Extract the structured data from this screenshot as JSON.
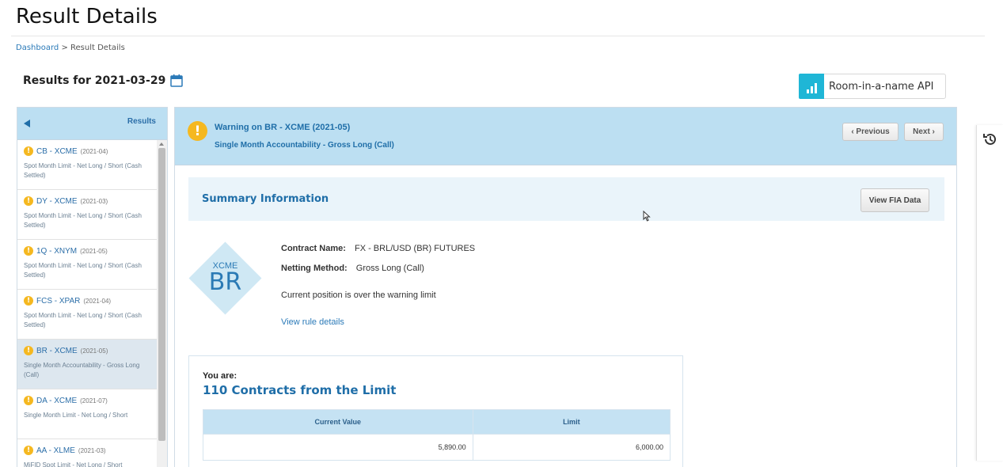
{
  "page": {
    "title": "Result Details",
    "breadcrumb": {
      "home": "Dashboard",
      "separator": ">",
      "current": "Result Details"
    },
    "results_for": "Results for 2021-03-29"
  },
  "api_button": {
    "label": "Room-in-a-name API",
    "icon": "bar-chart-icon",
    "icon_color": "#1fb6d6"
  },
  "sidebar": {
    "title": "Results",
    "items": [
      {
        "name": "CB - XCME",
        "date": "(2021-04)",
        "desc": "Spot Month Limit - Net Long / Short (Cash Settled)",
        "active": false
      },
      {
        "name": "DY - XCME",
        "date": "(2021-03)",
        "desc": "Spot Month Limit - Net Long / Short (Cash Settled)",
        "active": false
      },
      {
        "name": "1Q - XNYM",
        "date": "(2021-05)",
        "desc": "Spot Month Limit - Net Long / Short (Cash Settled)",
        "active": false
      },
      {
        "name": "FCS - XPAR",
        "date": "(2021-04)",
        "desc": "Spot Month Limit - Net Long / Short (Cash Settled)",
        "active": false
      },
      {
        "name": "BR - XCME",
        "date": "(2021-05)",
        "desc": "Single Month Accountability - Gross Long (Call)",
        "active": true
      },
      {
        "name": "DA - XCME",
        "date": "(2021-07)",
        "desc": "Single Month Limit - Net Long / Short",
        "active": false
      },
      {
        "name": "AA - XLME",
        "date": "(2021-03)",
        "desc": "MiFID Spot Limit - Net Long / Short",
        "active": false
      }
    ]
  },
  "detail": {
    "warning_title": "Warning on BR - XCME (2021-05)",
    "warning_subtitle": "Single Month Accountability - Gross Long (Call)",
    "prev_label": "‹ Previous",
    "next_label": "Next ›",
    "summary_title": "Summary Information",
    "fia_button": "View FIA Data",
    "badge_exchange": "XCME",
    "badge_code": "BR",
    "contract_label": "Contract Name:",
    "contract_value": "FX - BRL/USD (BR) FUTURES",
    "netting_label": "Netting Method:",
    "netting_value": "Gross Long (Call)",
    "position_status": "Current position is over the warning limit",
    "rule_link": "View rule details",
    "you_are": "You are:",
    "limit_headline": "110 Contracts from the Limit",
    "table": {
      "headers": [
        "Current Value",
        "Limit"
      ],
      "row": [
        "5,890.00",
        "6,000.00"
      ]
    }
  },
  "colors": {
    "accent": "#1f6ea8",
    "header_bg": "#bcdff2",
    "warning": "#f5b820"
  }
}
